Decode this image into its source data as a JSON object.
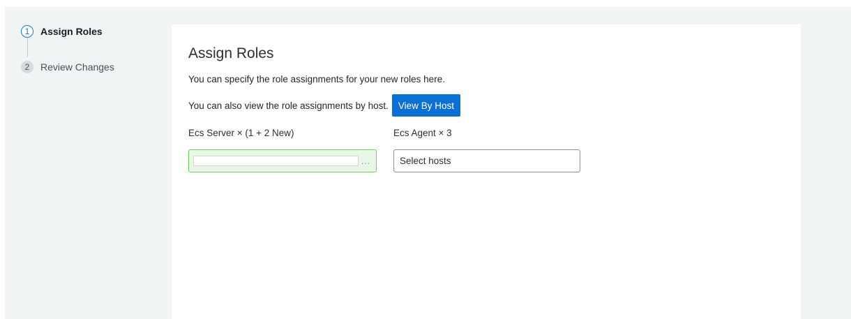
{
  "wizard": {
    "steps": [
      {
        "number": "1",
        "label": "Assign Roles",
        "state": "active"
      },
      {
        "number": "2",
        "label": "Review Changes",
        "state": "inactive"
      }
    ]
  },
  "main": {
    "title": "Assign Roles",
    "description": "You can specify the role assignments for your new roles here.",
    "view_by_host_text": "You can also view the role assignments by host.",
    "view_by_host_button": "View By Host",
    "roles": [
      {
        "label": "Ecs Server × (1 + 2 New)",
        "state": "assigned",
        "more": "..."
      },
      {
        "label": "Ecs Agent × 3",
        "state": "unassigned",
        "placeholder": "Select hosts"
      }
    ]
  },
  "colors": {
    "accent": "#0b6fd4",
    "assigned_border": "#69cf5e",
    "assigned_bg": "#e9f8e6",
    "page_bg": "#f1f4f4"
  }
}
